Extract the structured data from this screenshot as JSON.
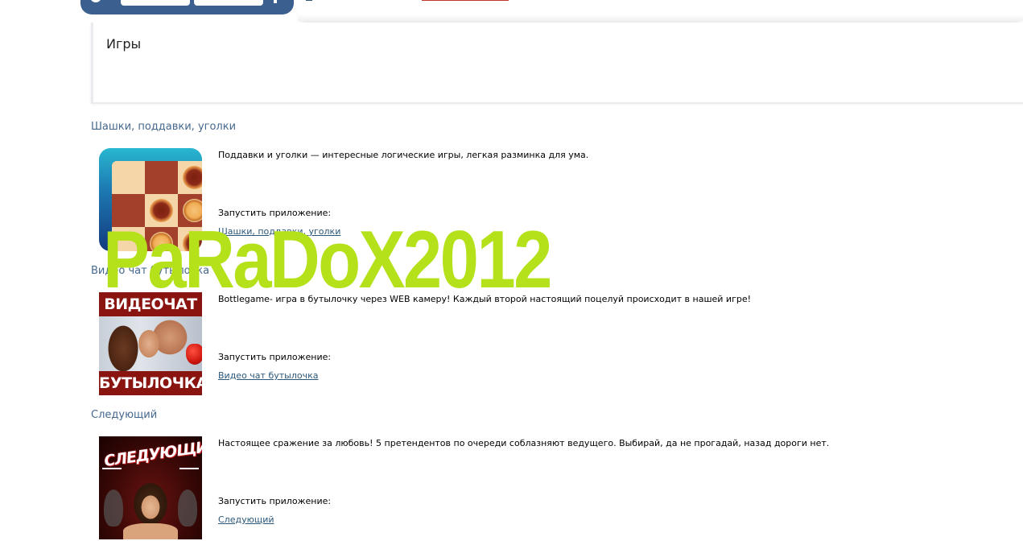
{
  "page": {
    "title": "Игры"
  },
  "apps": [
    {
      "heading": "Шашки, поддавки, уголки",
      "description": "Поддавки и уголки — интересные логические игры, легкая разминка для ума.",
      "launch_label": "Запустить приложение:",
      "launch_link": "Шашки, поддавки, уголки",
      "icon": "checkers-board-icon"
    },
    {
      "heading": "Видео чат бутылочка",
      "description": "Bottlegame- игра в бутылочку через WEB камеру! Каждый второй настоящий поцелуй происходит в нашей игре!",
      "launch_label": "Запустить приложение:",
      "launch_link": "Видео чат бутылочка",
      "icon": "kissing-couple-icon",
      "icon_top_text": "ВИДЕОЧАТ",
      "icon_bottom_text": "БУТЫЛОЧКА"
    },
    {
      "heading": "Следующий",
      "description": "Настоящее сражение за любовь! 5 претендентов по очереди соблазняют ведущего. Выбирай, да не прогадай, назад дороги нет.",
      "launch_label": "Запустить приложение:",
      "launch_link": "Следующий",
      "icon": "woman-portrait-icon",
      "icon_text": "СЛЕДУЮЩИЙ"
    }
  ],
  "watermark": {
    "text": "PaRaDoX2012"
  },
  "colors": {
    "header_blue": "#3b5f8f",
    "heading_blue": "#45688e",
    "link_blue": "#2b587a",
    "watermark_green": "#b4e11a"
  }
}
